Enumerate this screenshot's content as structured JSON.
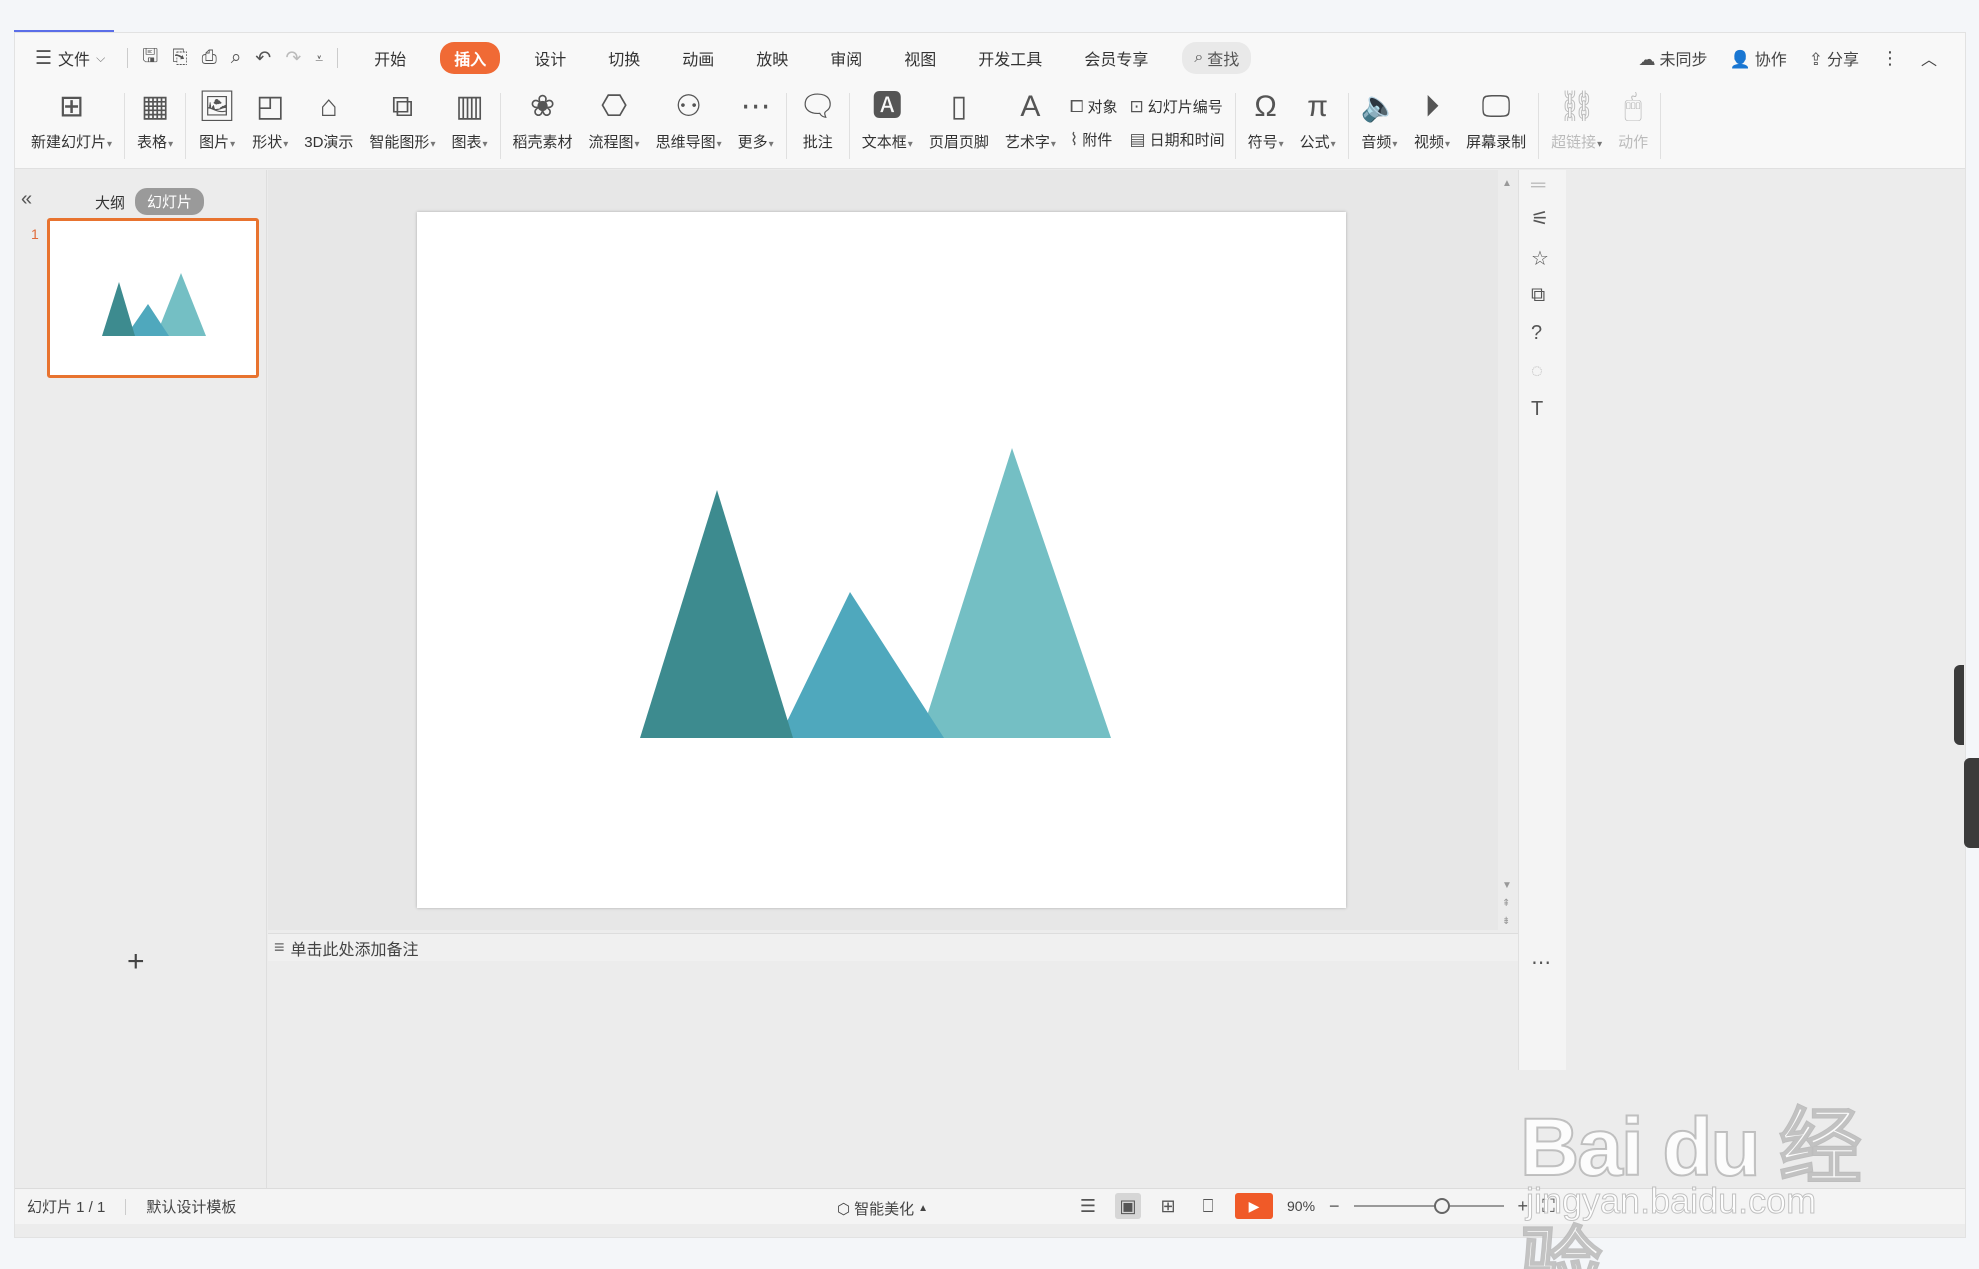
{
  "menubar": {
    "file_label": "文件",
    "tabs": [
      {
        "label": "开始",
        "active": false
      },
      {
        "label": "插入",
        "active": true
      },
      {
        "label": "设计",
        "active": false
      },
      {
        "label": "切换",
        "active": false
      },
      {
        "label": "动画",
        "active": false
      },
      {
        "label": "放映",
        "active": false
      },
      {
        "label": "审阅",
        "active": false
      },
      {
        "label": "视图",
        "active": false
      },
      {
        "label": "开发工具",
        "active": false
      },
      {
        "label": "会员专享",
        "active": false
      }
    ],
    "search_label": "查找",
    "sync_label": "未同步",
    "collab_label": "协作",
    "share_label": "分享"
  },
  "ribbon": {
    "new_slide": "新建幻灯片",
    "table": "表格",
    "picture": "图片",
    "shape": "形状",
    "demo3d": "3D演示",
    "smart_graphic": "智能图形",
    "chart": "图表",
    "docer_material": "稻壳素材",
    "flowchart": "流程图",
    "mindmap": "思维导图",
    "more": "更多",
    "comment": "批注",
    "textbox": "文本框",
    "header_footer": "页眉页脚",
    "wordart": "艺术字",
    "object": "对象",
    "slide_number": "幻灯片编号",
    "attachment": "附件",
    "datetime": "日期和时间",
    "symbol": "符号",
    "formula": "公式",
    "audio": "音频",
    "video": "视频",
    "screen_record": "屏幕录制",
    "hyperlink": "超链接",
    "action": "动作"
  },
  "left_panel": {
    "outline_tab": "大纲",
    "slides_tab": "幻灯片",
    "slide_number": "1"
  },
  "notes": {
    "placeholder": "单击此处添加备注"
  },
  "status": {
    "slide_info": "幻灯片 1 / 1",
    "template": "默认设计模板",
    "beautify": "智能美化",
    "zoom": "90%"
  },
  "slide_shapes": {
    "colors": [
      "#3d8b8f",
      "#4fa8bd",
      "#74bfc4"
    ]
  },
  "watermark": {
    "main": "Bai du 经验",
    "sub": "jingyan.baidu.com"
  }
}
